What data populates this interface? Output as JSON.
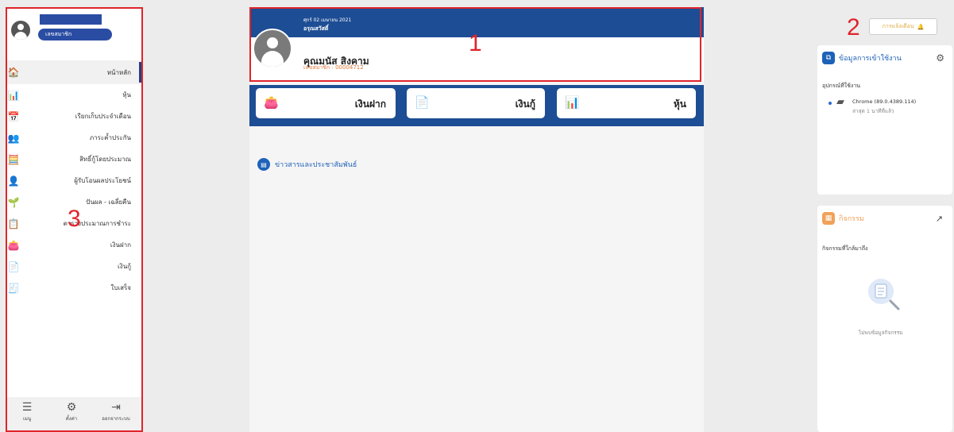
{
  "annotations": {
    "one": "1",
    "two": "2",
    "three": "3"
  },
  "sidebar": {
    "member_label": "เลขสมาชิก",
    "items": [
      {
        "label": "หน้าหลัก",
        "icon": "home-icon",
        "glyph": "🏠",
        "active": true
      },
      {
        "label": "หุ้น",
        "icon": "stock-chart-icon",
        "glyph": "📊"
      },
      {
        "label": "เรียกเก็บประจำเดือน",
        "icon": "calendar-icon",
        "glyph": "📅"
      },
      {
        "label": "ภาระค้ำประกัน",
        "icon": "guarantor-people-icon",
        "glyph": "👥"
      },
      {
        "label": "สิทธิ์กู้โดยประมาณ",
        "icon": "loan-calculator-icon",
        "glyph": "🧮"
      },
      {
        "label": "ผู้รับโอนผลประโยชน์",
        "icon": "beneficiary-icon",
        "glyph": "👤"
      },
      {
        "label": "ปันผล - เฉลี่ยคืน",
        "icon": "dividend-plant-icon",
        "glyph": "🌱"
      },
      {
        "label": "ตารางประมาณการชำระ",
        "icon": "payment-table-icon",
        "glyph": "📋"
      },
      {
        "label": "เงินฝาก",
        "icon": "wallet-icon",
        "glyph": "👛"
      },
      {
        "label": "เงินกู้",
        "icon": "loan-document-icon",
        "glyph": "📄"
      },
      {
        "label": "ใบเสร็จ",
        "icon": "receipt-icon",
        "glyph": "🧾"
      }
    ],
    "bottom": [
      {
        "label": "เมนู",
        "icon": "menu-list-icon",
        "glyph": "☰"
      },
      {
        "label": "ตั้งค่า",
        "icon": "settings-gear-icon",
        "glyph": "⚙"
      },
      {
        "label": "ออกจากระบบ",
        "icon": "logout-icon",
        "glyph": "⇥"
      }
    ]
  },
  "header": {
    "date": "ศุกร์ 02 เมษายน 2021",
    "greeting": "อรุณสวัสดิ์",
    "user_name": "คุณมนัส สิงคาม",
    "member_id": "เลขสมาชิก : 00004712"
  },
  "cards": [
    {
      "label": "เงินฝาก",
      "icon": "wallet-icon",
      "glyph": "👛"
    },
    {
      "label": "เงินกู้",
      "icon": "loan-document-icon",
      "glyph": "📄"
    },
    {
      "label": "หุ้น",
      "icon": "stock-chart-icon",
      "glyph": "📊"
    }
  ],
  "news": {
    "title": "ข่าวสารและประชาสัมพันธ์"
  },
  "notification": {
    "label": "การแจ้งเตือน"
  },
  "login_panel": {
    "title": "ข้อมูลการเข้าใช้งาน",
    "section": "อุปกรณ์ที่ใช้งาน",
    "device_name": "Chrome (89.0.4389.114)",
    "last_seen": "ล่าสุด 1 นาทีที่แล้ว"
  },
  "activity_panel": {
    "title": "กิจกรรม",
    "section": "กิจกรรมที่ใกล้มาถึง",
    "empty_text": "ไม่พบข้อมูลกิจกรรม"
  },
  "colors": {
    "primary": "#1d4d94",
    "accent_blue": "#1e62b8",
    "activity_orange": "#f0a25a",
    "annotation_red": "#e0242b"
  }
}
